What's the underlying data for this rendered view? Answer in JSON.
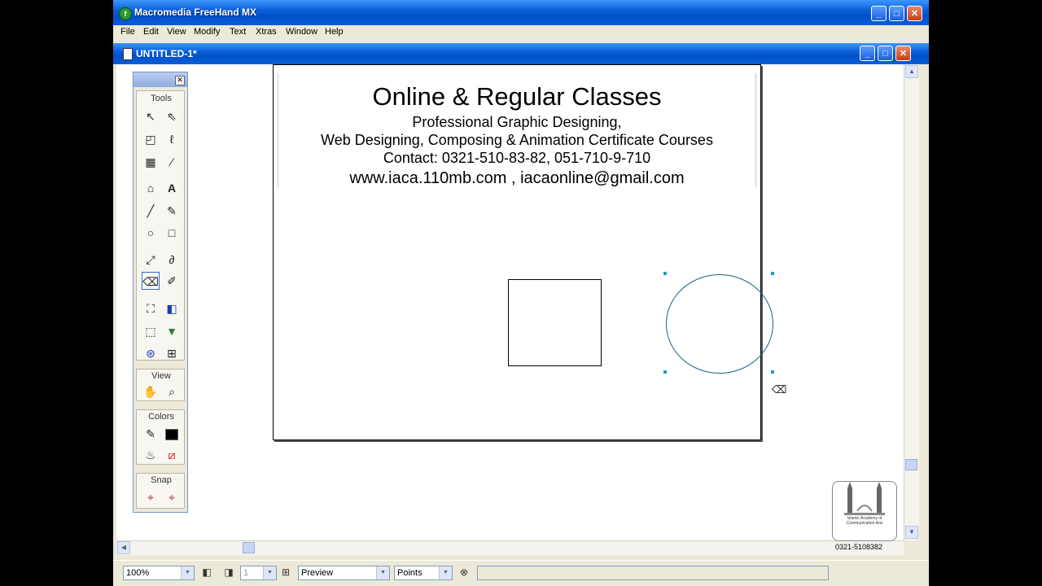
{
  "window": {
    "title": "Macromedia FreeHand MX",
    "doc_title": "UNTITLED-1*"
  },
  "menu": [
    "File",
    "Edit",
    "View",
    "Modify",
    "Text",
    "Xtras",
    "Window",
    "Help"
  ],
  "toolbox": {
    "sections": [
      "Tools",
      "View",
      "Colors",
      "Snap"
    ]
  },
  "document": {
    "heading": "Online & Regular Classes",
    "line1": "Professional Graphic Designing,",
    "line2": "Web Designing, Composing & Animation Certificate Courses",
    "line3": "Contact: 0321-510-83-82, 051-710-9-710",
    "line4": "www.iaca.110mb.com , iacaonline@gmail.com"
  },
  "statusbar": {
    "zoom": "100%",
    "page_number": "1",
    "view_mode": "Preview",
    "units": "Points"
  },
  "watermark": {
    "logo_text": "Islamic Academy of Communication Arts",
    "phone": "0321-5108382"
  },
  "colors": {
    "titlebar": "#0a5fd8",
    "circle_stroke": "#1f5f7a",
    "handle": "#1f9ad6"
  }
}
